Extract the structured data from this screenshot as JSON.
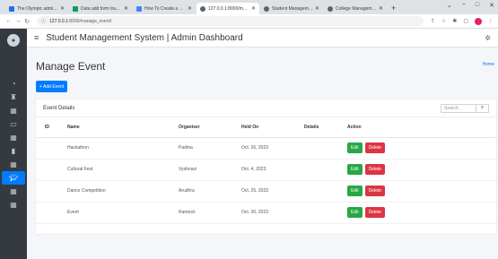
{
  "browser": {
    "tabs": [
      {
        "label": "The Olympic administrat",
        "color": "#1a73e8"
      },
      {
        "label": "Data add form tracker",
        "color": "#0f9d58"
      },
      {
        "label": "How To Create a File",
        "color": "#4285f4"
      },
      {
        "label": "127.0.0.1:8000/manag",
        "color": "#5f6368",
        "active": true
      },
      {
        "label": "Student Management",
        "color": "#5f6368"
      },
      {
        "label": "College Management",
        "color": "#5f6368"
      }
    ],
    "new_tab": "+",
    "url_host": "127.0.0.1",
    "url_path": ":8000/manage_event/"
  },
  "app": {
    "title": "Student Management System | Admin Dashboard"
  },
  "page": {
    "title": "Manage Event",
    "breadcrumb": "Home",
    "add_button": "+ Add Event"
  },
  "card": {
    "title": "Event Details",
    "search_placeholder": "Search"
  },
  "table": {
    "headers": [
      "ID",
      "Name",
      "Organiser",
      "Held On",
      "Details",
      "Action"
    ],
    "rows": [
      {
        "id": "",
        "name": "Hackathon",
        "organiser": "Padma",
        "held_on": "Oct. 26, 2023",
        "details": ""
      },
      {
        "id": "",
        "name": "Cultural Fest",
        "organiser": "Vyshnavi",
        "held_on": "Oct. 4, 2023",
        "details": ""
      },
      {
        "id": "",
        "name": "Dance Competition",
        "organiser": "Arudhra",
        "held_on": "Oct. 25, 2023",
        "details": ""
      },
      {
        "id": "",
        "name": "Event",
        "organiser": "Ramesh",
        "held_on": "Oct. 30, 2023",
        "details": ""
      }
    ],
    "edit_label": "Edit",
    "delete_label": "Delete"
  },
  "colors": {
    "primary": "#007bff",
    "success": "#28a745",
    "danger": "#dc3545",
    "sidebar": "#343a40"
  },
  "icons": {
    "sidebar": [
      "dashboard-icon",
      "users-icon",
      "table-icon",
      "monitor-icon",
      "table-icon",
      "book-icon",
      "table-icon",
      "graduation-cap-icon",
      "table-icon",
      "table-icon"
    ]
  }
}
